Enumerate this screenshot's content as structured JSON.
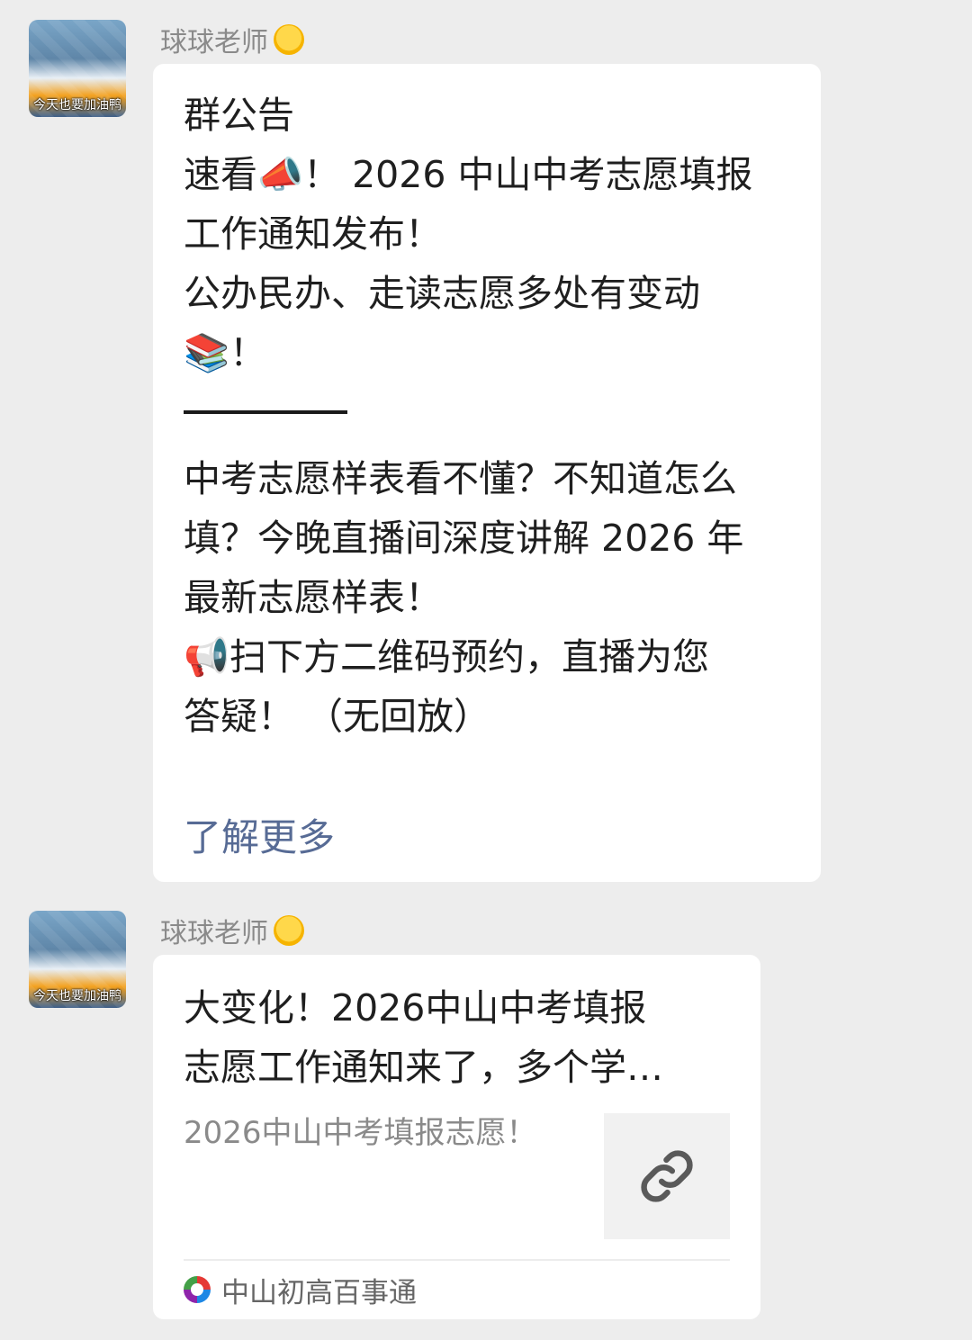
{
  "messages": [
    {
      "sender": "球球老师",
      "avatar_caption": "今天也要加油鸭",
      "announcement": {
        "body": "群公告\n速看📣！ 2026 中山中考志愿填报\n工作通知发布！\n公办民办、走读志愿多处有变动\n📚！",
        "body2": "中考志愿样表看不懂？不知道怎么\n填？今晚直播间深度讲解 2026 年\n最新志愿样表！\n📢扫下方二维码预约，直播为您\n答疑！ （无回放）",
        "more_link": "了解更多"
      }
    },
    {
      "sender": "球球老师",
      "avatar_caption": "今天也要加油鸭",
      "link_card": {
        "title": "大变化！2026中山中考填报\n志愿工作通知来了，多个学…",
        "description": "2026中山中考填报志愿！",
        "thumbnail_icon": "link-icon",
        "source": "中山初高百事通"
      }
    }
  ],
  "colors": {
    "background": "#ededed",
    "bubble": "#ffffff",
    "link": "#576b95",
    "sender_name": "#8a8a8a"
  }
}
